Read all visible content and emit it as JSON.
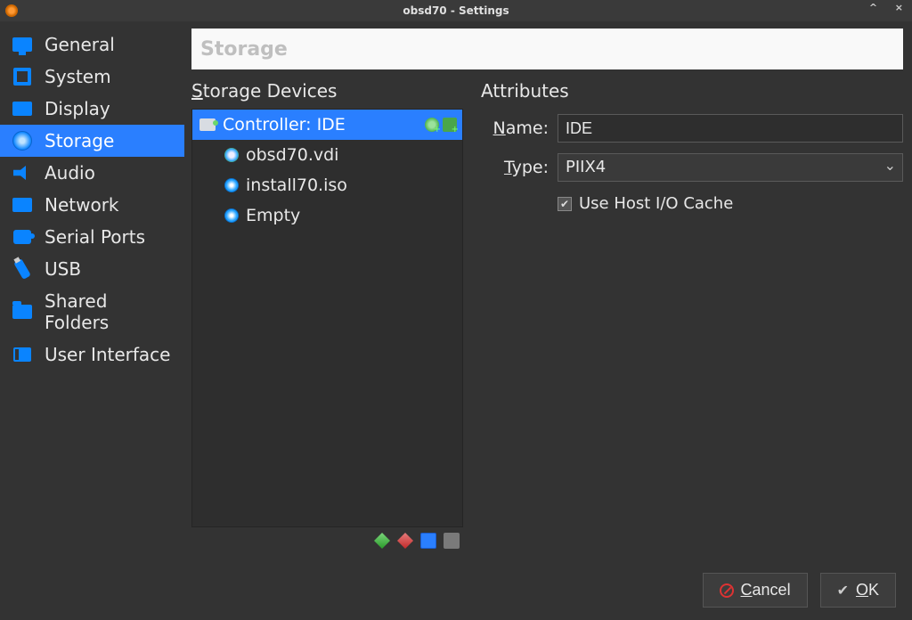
{
  "window": {
    "title": "obsd70 - Settings"
  },
  "sidebar": {
    "items": [
      {
        "label": "General"
      },
      {
        "label": "System"
      },
      {
        "label": "Display"
      },
      {
        "label": "Storage"
      },
      {
        "label": "Audio"
      },
      {
        "label": "Network"
      },
      {
        "label": "Serial Ports"
      },
      {
        "label": "USB"
      },
      {
        "label": "Shared Folders"
      },
      {
        "label": "User Interface"
      }
    ]
  },
  "banner": {
    "title": "Storage"
  },
  "storage": {
    "devices_label": "torage Devices",
    "controller_label": "Controller: IDE",
    "items": [
      {
        "label": "obsd70.vdi"
      },
      {
        "label": "install70.iso"
      },
      {
        "label": "Empty"
      }
    ]
  },
  "attributes": {
    "title": "Attributes",
    "name_label": "ame:",
    "name_value": "IDE",
    "type_label": "ype:",
    "type_value": "PIIX4",
    "cache_label": "Use Host I/O Cache",
    "cache_checked": true
  },
  "footer": {
    "cancel": "ancel",
    "ok": "K"
  }
}
